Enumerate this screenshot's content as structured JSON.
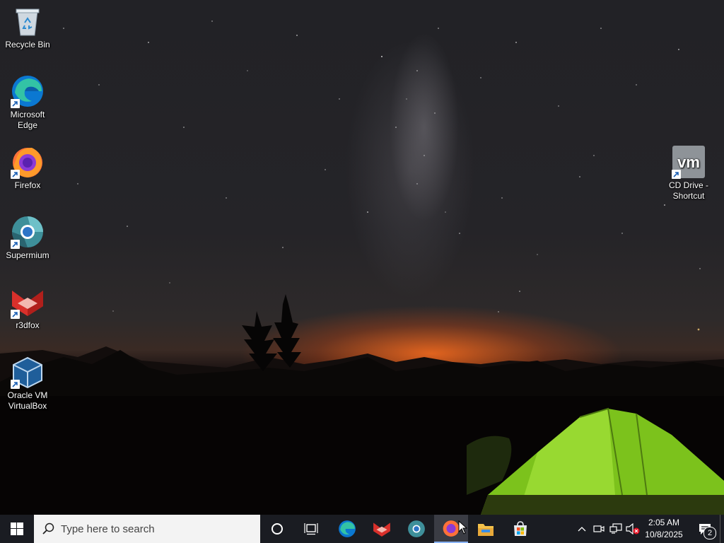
{
  "desktop": {
    "icons": [
      {
        "label": "Recycle Bin",
        "icon": "recycle-bin-icon"
      },
      {
        "label": "Microsoft\nEdge",
        "icon": "edge-icon"
      },
      {
        "label": "Firefox",
        "icon": "firefox-icon"
      },
      {
        "label": "Supermium",
        "icon": "supermium-icon"
      },
      {
        "label": "r3dfox",
        "icon": "r3dfox-icon"
      },
      {
        "label": "Oracle VM\nVirtualBox",
        "icon": "virtualbox-icon"
      },
      {
        "label": "CD Drive -\nShortcut",
        "icon": "vm-cd-drive-icon"
      }
    ]
  },
  "taskbar": {
    "search_placeholder": "Type here to search",
    "pinned": [
      "edge-icon",
      "r3dfox-icon",
      "supermium-icon",
      "firefox-icon",
      "file-explorer-icon",
      "microsoft-store-icon"
    ],
    "active_app": "firefox",
    "clock": {
      "time": "2:05 AM",
      "date": "10/8/2025"
    },
    "notification_count": "2"
  }
}
